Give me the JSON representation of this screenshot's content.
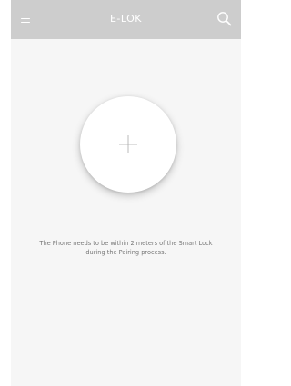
{
  "app": {
    "title": "E-LOK"
  },
  "header": {
    "menu_icon": "hamburger-menu-icon",
    "search_icon": "search-icon"
  },
  "main": {
    "add_button_icon": "plus-icon",
    "notice_line1": "The Phone needs to be within 2 meters of the Smart Lock",
    "notice_line2": "during the Pairing process."
  },
  "colors": {
    "header_bg": "#cdcdcd",
    "screen_bg": "#f6f6f6",
    "text": "#777777",
    "icon": "#ffffff"
  }
}
